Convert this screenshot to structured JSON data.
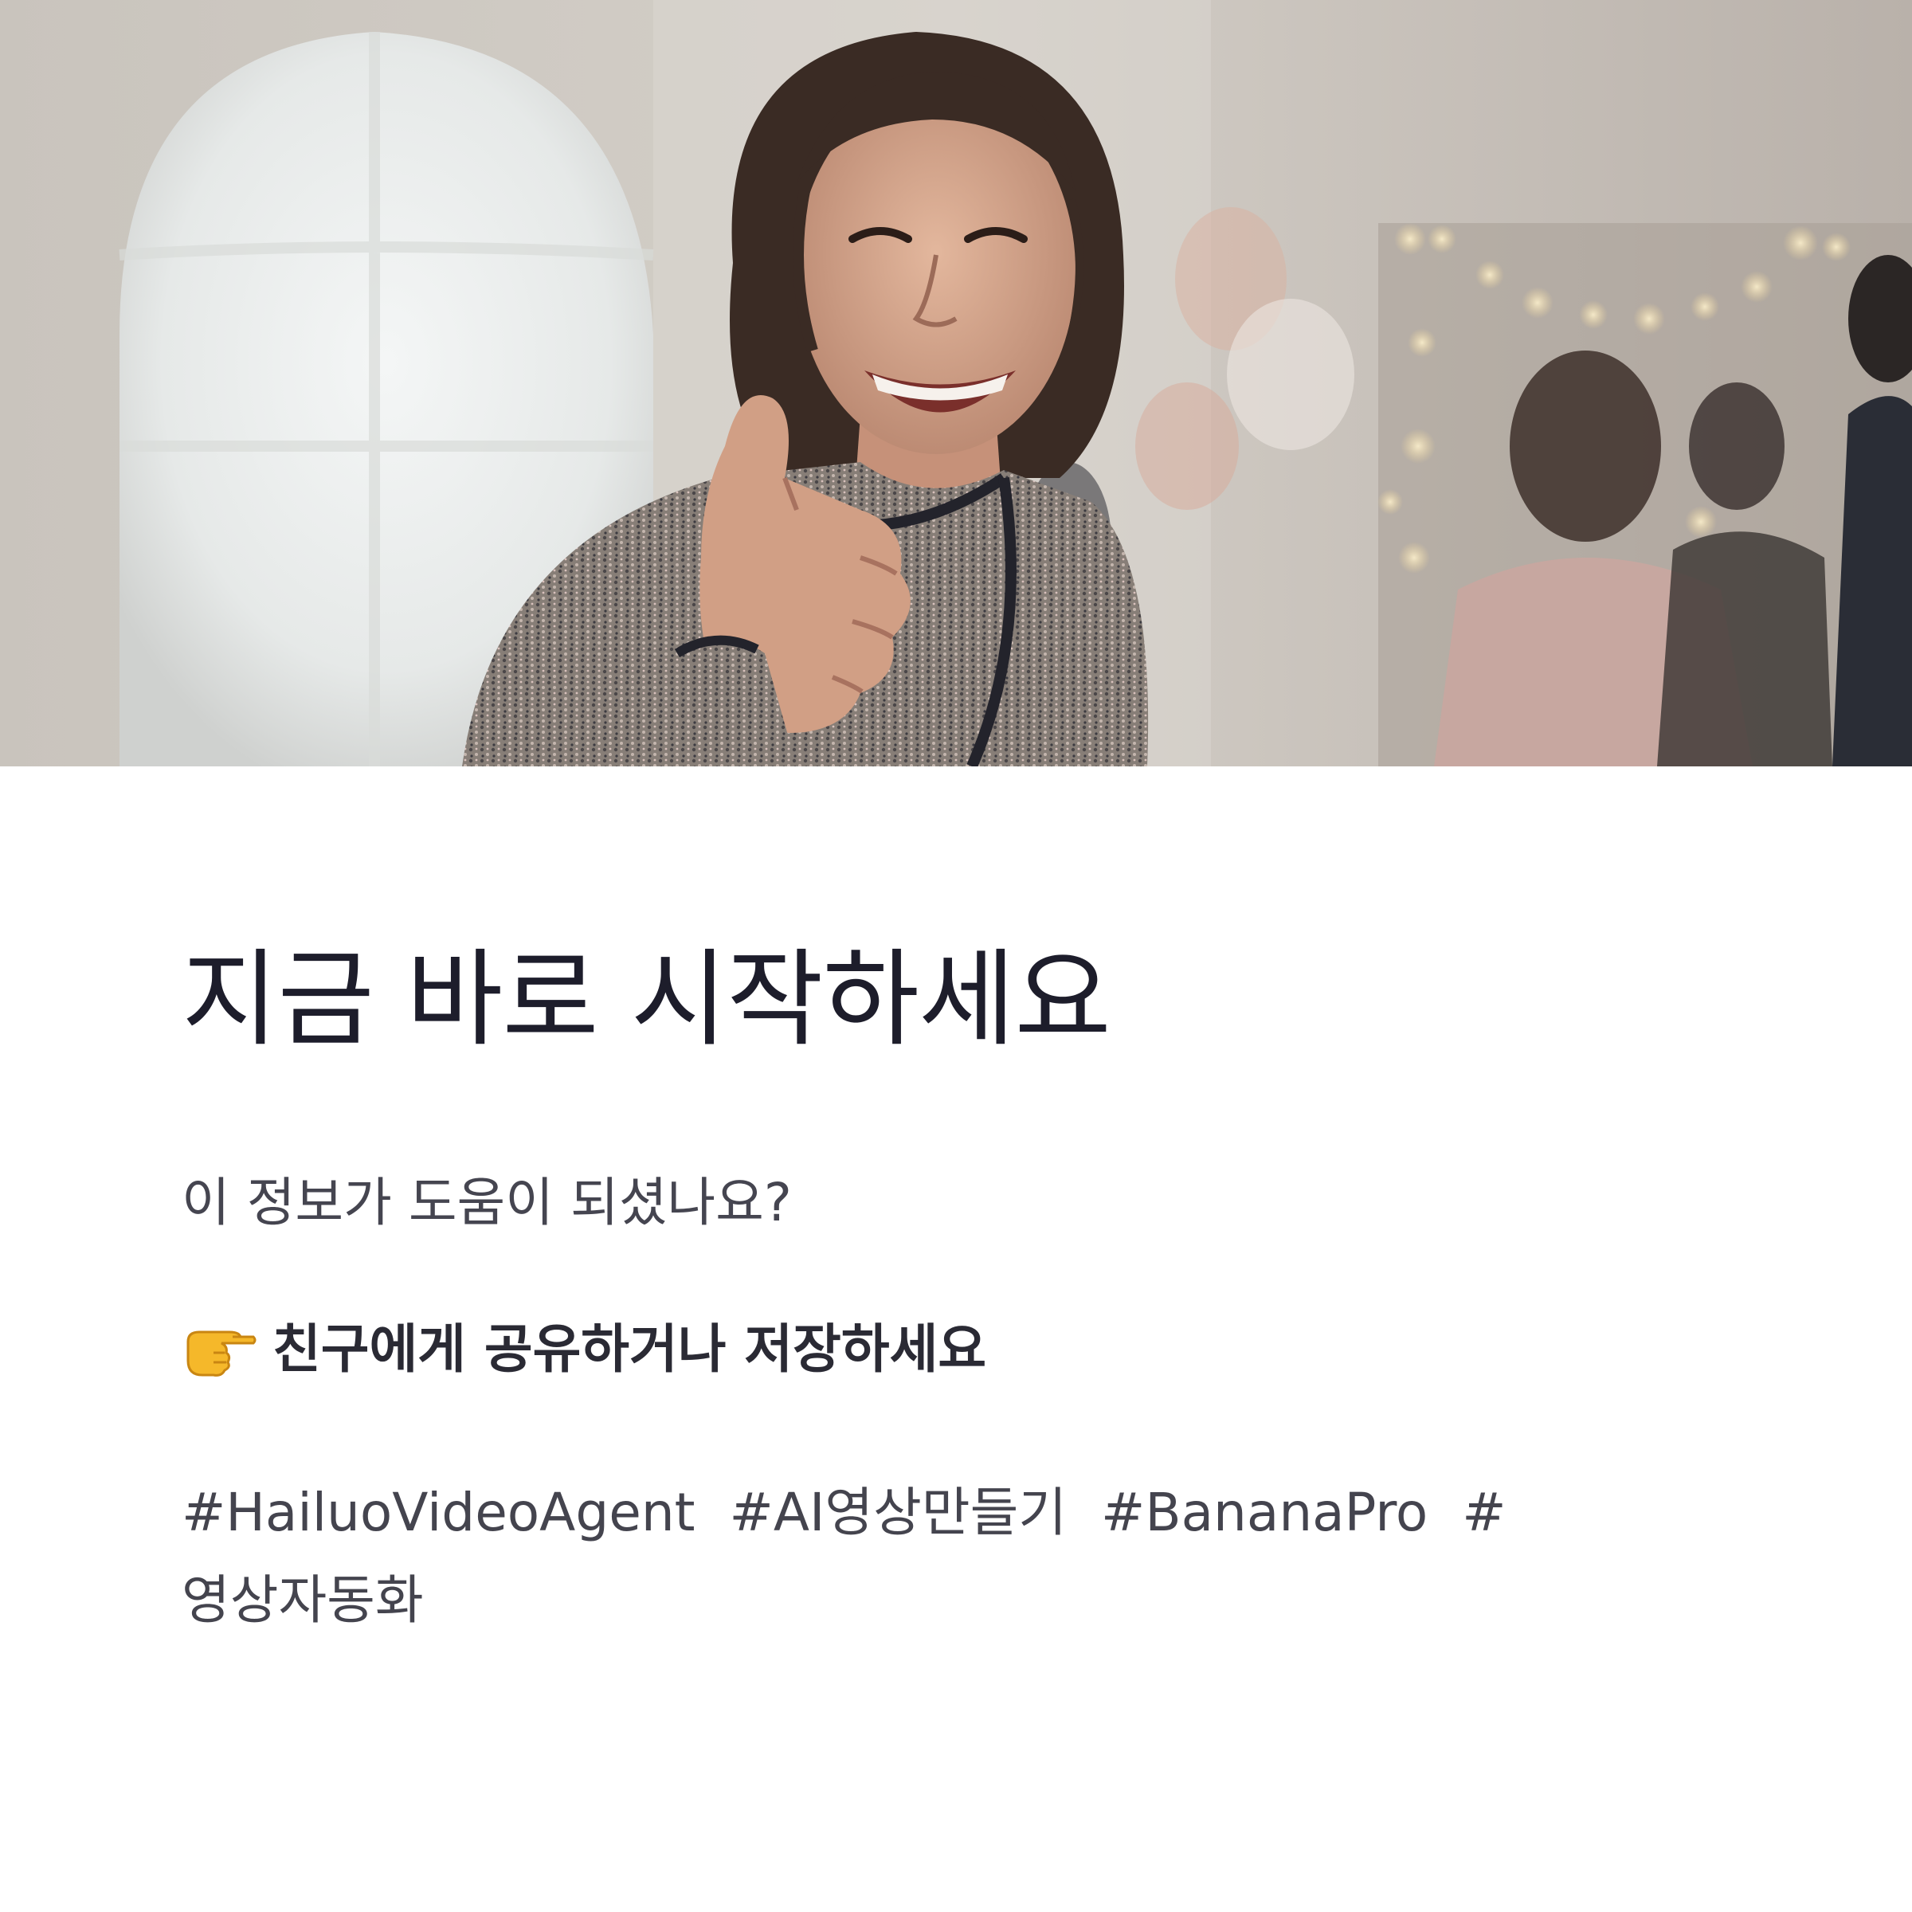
{
  "hero": {
    "image_description": "",
    "icon": "hero-photo"
  },
  "headline": "지금 바로 시작하세요",
  "question": "이 정보가 도움이 되셨나요?",
  "cta": {
    "icon": "pointing-hand-icon",
    "label": "친구에게 공유하거나 저장하세요"
  },
  "hashtags": [
    "#HailuoVideoAgent",
    "#AI영상만들기",
    "#BananaPro",
    "#영상자동화"
  ],
  "colors": {
    "headline": "#1d1d2b",
    "body": "#454550",
    "background": "#ffffff"
  }
}
